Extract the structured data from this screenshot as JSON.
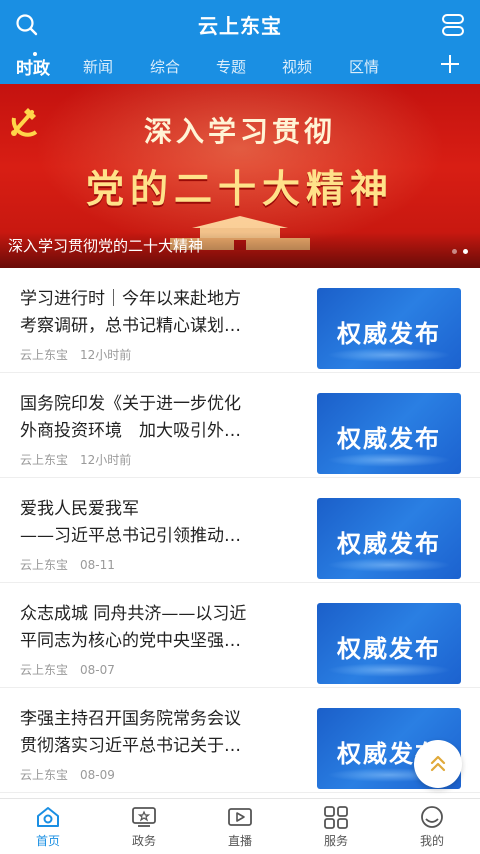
{
  "header": {
    "title": "云上东宝"
  },
  "tabs": [
    {
      "label": "时政",
      "active": true
    },
    {
      "label": "新闻",
      "active": false
    },
    {
      "label": "综合",
      "active": false
    },
    {
      "label": "专题",
      "active": false
    },
    {
      "label": "视频",
      "active": false
    },
    {
      "label": "区情",
      "active": false
    }
  ],
  "banner": {
    "headline_1": "深入学习贯彻",
    "headline_2": "党的二十大精神",
    "caption": "深入学习贯彻党的二十大精神",
    "page_count": 2,
    "current_page": 2
  },
  "news": [
    {
      "title_line1": "学习进行时｜今年以来赴地方",
      "title_line2": "考察调研，总书记精心谋划…",
      "source": "云上东宝",
      "time": "12小时前",
      "thumb_text": "权威发布"
    },
    {
      "title_line1": "国务院印发《关于进一步优化",
      "title_line2": "外商投资环境　加大吸引外…",
      "source": "云上东宝",
      "time": "12小时前",
      "thumb_text": "权威发布"
    },
    {
      "title_line1": "爱我人民爱我军",
      "title_line2": "——习近平总书记引领推动…",
      "source": "云上东宝",
      "time": "08-11",
      "thumb_text": "权威发布"
    },
    {
      "title_line1": "众志成城 同舟共济——以习近",
      "title_line2": "平同志为核心的党中央坚强…",
      "source": "云上东宝",
      "time": "08-07",
      "thumb_text": "权威发布"
    },
    {
      "title_line1": "李强主持召开国务院常务会议",
      "title_line2": "贯彻落实习近平总书记关于…",
      "source": "云上东宝",
      "time": "08-09",
      "thumb_text": "权威发布"
    }
  ],
  "bottom_nav": [
    {
      "label": "首页",
      "icon": "home-icon",
      "active": true
    },
    {
      "label": "政务",
      "icon": "government-icon",
      "active": false
    },
    {
      "label": "直播",
      "icon": "live-icon",
      "active": false
    },
    {
      "label": "服务",
      "icon": "services-icon",
      "active": false
    },
    {
      "label": "我的",
      "icon": "profile-icon",
      "active": false
    }
  ],
  "colors": {
    "accent": "#1a8fe3",
    "banner_red": "#d81e14",
    "thumb_blue": "#2a7fe3"
  }
}
